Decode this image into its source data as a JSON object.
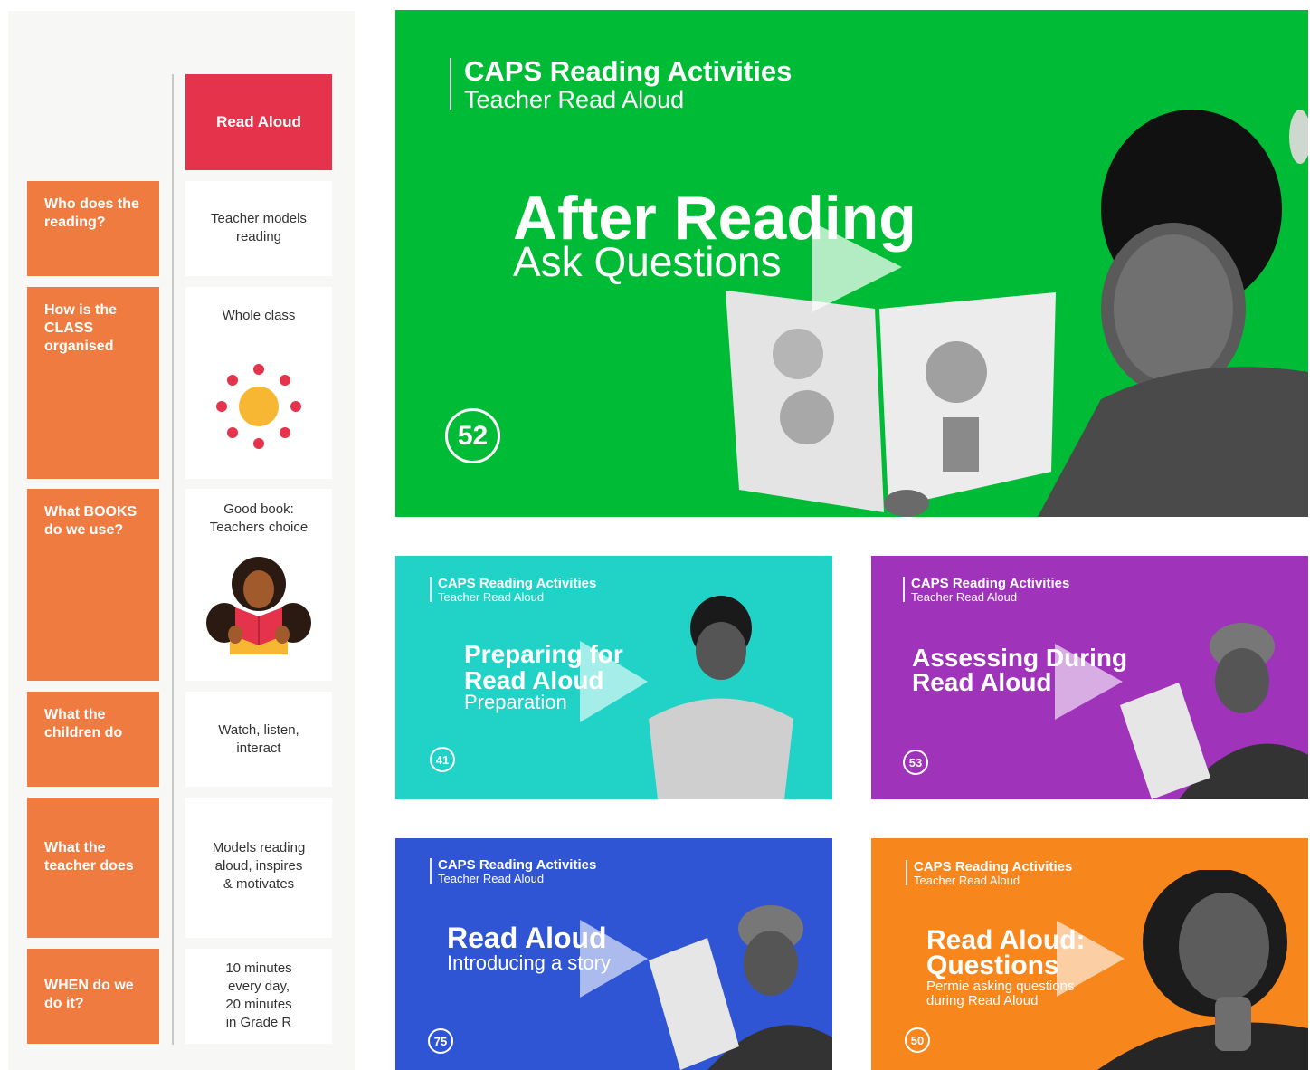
{
  "chart": {
    "header": "Read Aloud",
    "rows": [
      {
        "question": "Who does the reading?",
        "answer": "Teacher models\nreading"
      },
      {
        "question": "How is the CLASS organised",
        "answer": "Whole class"
      },
      {
        "question": "What BOOKS do we use?",
        "answer": "Good book:\nTeachers choice"
      },
      {
        "question": "What the children do",
        "answer": "Watch, listen,\ninteract"
      },
      {
        "question": "What the teacher does",
        "answer": "Models reading\naloud, inspires\n& motivates"
      },
      {
        "question": "WHEN do we do it?",
        "answer": "10 minutes\nevery day,\n20 minutes\nin Grade R"
      }
    ]
  },
  "videos": [
    {
      "brand": "CAPS Reading Activities",
      "brand_sub": "Teacher Read Aloud",
      "title": "After Reading",
      "subtitle": "Ask Questions",
      "number": "52",
      "color": "#00bb35"
    },
    {
      "brand": "CAPS Reading Activities",
      "brand_sub": "Teacher Read Aloud",
      "title": "Preparing for\nRead Aloud",
      "subtitle": "Preparation",
      "number": "41",
      "color": "#20d3c6"
    },
    {
      "brand": "CAPS Reading Activities",
      "brand_sub": "Teacher Read Aloud",
      "title": "Assessing During\nRead Aloud",
      "subtitle": "",
      "number": "53",
      "color": "#9f33b9"
    },
    {
      "brand": "CAPS Reading Activities",
      "brand_sub": "Teacher Read Aloud",
      "title": "Read Aloud",
      "subtitle": "Introducing a story",
      "number": "75",
      "color": "#2f55d4"
    },
    {
      "brand": "CAPS Reading Activities",
      "brand_sub": "Teacher Read Aloud",
      "title": "Read Aloud:\nQuestions",
      "subtitle": "Permie asking questions\nduring Read Aloud",
      "number": "50",
      "color": "#f7861c"
    }
  ],
  "icons": {
    "class_icon": "sun-with-dots-icon",
    "books_icon": "reading-woman-icon",
    "play": "play-icon"
  }
}
